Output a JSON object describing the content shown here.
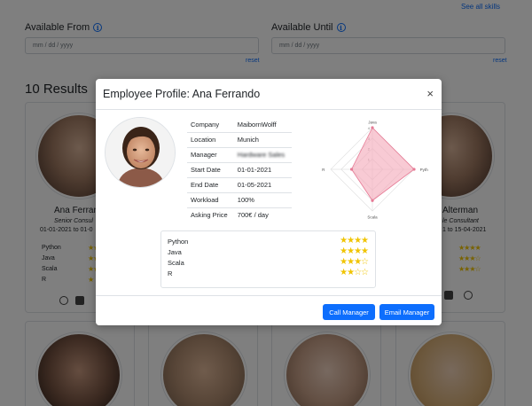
{
  "header": {
    "see_all_skills": "See all skills"
  },
  "filters": {
    "available_from_label": "Available From",
    "available_until_label": "Available Until",
    "date_placeholder": "mm / dd / yyyy",
    "reset_label": "reset"
  },
  "results": {
    "title": "10 Results",
    "cards": [
      {
        "name_visible": "Ana Ferran",
        "role_visible": "Senior Consul",
        "dates_visible": "01-01-2021 to 01-0",
        "skills": [
          {
            "name": "Python",
            "stars": 4
          },
          {
            "name": "Java",
            "stars": 4
          },
          {
            "name": "Scala",
            "stars": 3
          },
          {
            "name": "R",
            "stars": 2
          }
        ]
      },
      {
        "name_visible": "Alterman",
        "role_visible": "le Consultant",
        "dates_visible": "1 to 15-04-2021",
        "skills": [
          {
            "name": "",
            "stars": 4
          },
          {
            "name": "",
            "stars": 3
          },
          {
            "name": "",
            "stars": 3
          }
        ]
      }
    ]
  },
  "modal": {
    "title": "Employee Profile: Ana Ferrando",
    "close_symbol": "×",
    "fields": [
      {
        "label": "Company",
        "value": "MaibornWolff"
      },
      {
        "label": "Location",
        "value": "Munich"
      },
      {
        "label": "Manager",
        "value": "Hardware Sales",
        "blurred": true
      },
      {
        "label": "Start Date",
        "value": "01-01-2021"
      },
      {
        "label": "End Date",
        "value": "01-05-2021"
      },
      {
        "label": "Workload",
        "value": "100%"
      },
      {
        "label": "Asking Price",
        "value": "700€ / day"
      }
    ],
    "radar": {
      "axes": [
        "Java",
        "Python",
        "Scala",
        "R"
      ],
      "scale_labels": [
        "1",
        "2",
        "3",
        "4"
      ],
      "values": [
        4,
        4,
        3,
        2
      ],
      "max": 4,
      "fill_color": "#f4a6b8",
      "stroke_color": "#e67a95"
    },
    "skills": [
      {
        "name": "Python",
        "stars": 4,
        "display": "★★★★"
      },
      {
        "name": "Java",
        "stars": 4,
        "display": "★★★★"
      },
      {
        "name": "Scala",
        "stars": 3,
        "display": "★★★☆"
      },
      {
        "name": "R",
        "stars": 2,
        "display": "★★☆☆"
      }
    ],
    "buttons": {
      "call_manager": "Call Manager",
      "email_manager": "Email Manager"
    }
  },
  "colors": {
    "primary": "#0d6efd",
    "star": "#f0c400",
    "backdrop": "rgba(0,0,0,0.5)"
  }
}
